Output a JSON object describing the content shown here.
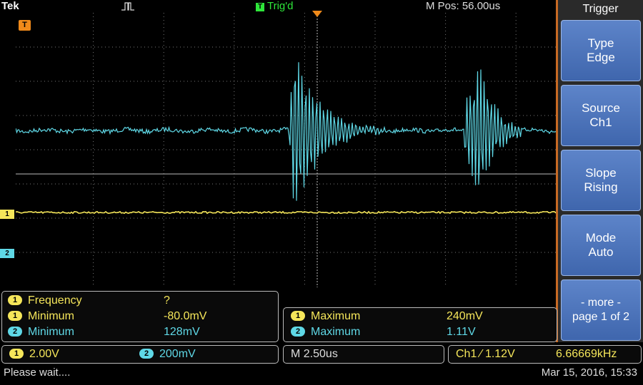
{
  "topbar": {
    "brand": "Tek",
    "trig_label": "Trig'd",
    "trig_box": "T",
    "mpos": "M Pos: 56.00us",
    "acq_icon": "pulse-waveform-icon"
  },
  "channels": [
    {
      "id": "1",
      "color": "#f5e65a"
    },
    {
      "id": "2",
      "color": "#5fd8e6"
    }
  ],
  "trigger_marker": "T",
  "menu": {
    "title": "Trigger",
    "buttons": [
      {
        "line1": "Type",
        "line2": "Edge"
      },
      {
        "line1": "Source",
        "line2": "Ch1"
      },
      {
        "line1": "Slope",
        "line2": "Rising"
      },
      {
        "line1": "Mode",
        "line2": "Auto"
      },
      {
        "line1": "- more -",
        "line2": "page 1 of 2"
      }
    ]
  },
  "measurements_left": [
    {
      "ch": "1",
      "name": "Frequency",
      "value": "?"
    },
    {
      "ch": "1",
      "name": "Minimum",
      "value": "-80.0mV"
    },
    {
      "ch": "2",
      "name": "Minimum",
      "value": "128mV"
    }
  ],
  "measurements_right": [
    {
      "ch": "1",
      "name": "Maximum",
      "value": "240mV"
    },
    {
      "ch": "2",
      "name": "Maximum",
      "value": "1.11V"
    }
  ],
  "scale": {
    "ch1_badge": "1",
    "ch1": "2.00V",
    "ch2_badge": "2",
    "ch2": "200mV",
    "timebase": "M 2.50us"
  },
  "trigger_readout": {
    "source": "Ch1",
    "slope_symbol": "⁄",
    "level": "1.12V",
    "freq": "6.66669kHz"
  },
  "status": {
    "message": "Please wait....",
    "datetime": "Mar 15, 2016, 15:33"
  },
  "colors": {
    "ch1": "#f5e65a",
    "ch2": "#5fd8e6",
    "trigger": "#f08a1a",
    "trig_status": "#2ee63a",
    "menu_button": "#4a72b8"
  }
}
